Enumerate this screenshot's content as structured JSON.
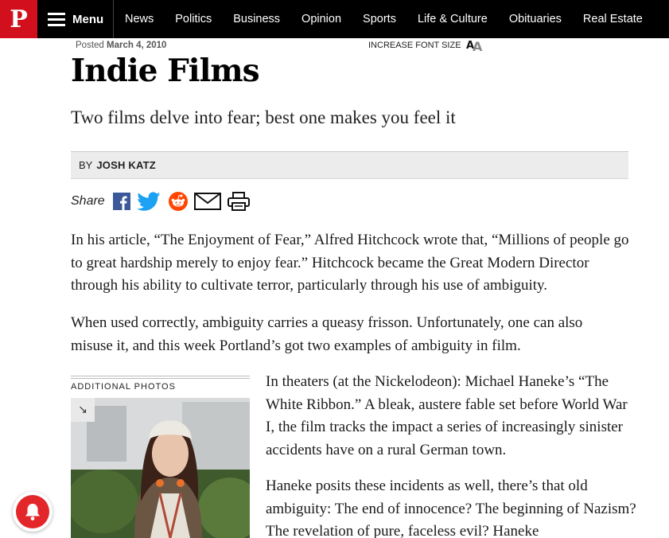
{
  "nav": {
    "logo": "P",
    "menu_label": "Menu",
    "links": [
      "News",
      "Politics",
      "Business",
      "Opinion",
      "Sports",
      "Life & Culture",
      "Obituaries",
      "Real Estate"
    ]
  },
  "article": {
    "posted_label": "Posted",
    "posted_date": "March 4, 2010",
    "font_size_label": "INCREASE FONT SIZE",
    "title": "Indie Films",
    "subtitle": "Two films delve into fear; best one makes you feel it",
    "by_label": "BY",
    "author": "JOSH KATZ",
    "share_label": "Share",
    "paragraphs": [
      "In his article, “The Enjoyment of Fear,” Alfred Hitchcock wrote that, “Millions of people go to great hardship merely to enjoy fear.” Hitchcock became the Great Modern Director through his ability to cultivate terror, particularly through his use of ambiguity.",
      "When used correctly, ambiguity carries a queasy frisson. Unfortunately, one can also misuse it, and this week Portland’s got two examples of ambiguity in film.",
      "In theaters (at the Nickelodeon): Michael Haneke’s “The White Ribbon.” A bleak, austere fable set before World War I, the film tracks the impact a series of increasingly sinister accidents have on a rural German town.",
      "Haneke posits these incidents as well, there’s that old ambiguity: The end of innocence? The beginning of Nazism? The revelation of pure, faceless evil? Haneke"
    ],
    "additional_photos_label": "ADDITIONAL PHOTOS",
    "expand_glyph": "↘"
  },
  "icons": [
    "facebook-icon",
    "twitter-icon",
    "reddit-icon",
    "email-icon",
    "print-icon",
    "notification-bell-icon",
    "font-size-icon"
  ],
  "colors": {
    "brand_red": "#d20f1d",
    "nav_bg": "#000000",
    "facebook": "#3b5998",
    "twitter": "#1da1f2",
    "reddit": "#ff4500",
    "bell": "#e3262a"
  }
}
